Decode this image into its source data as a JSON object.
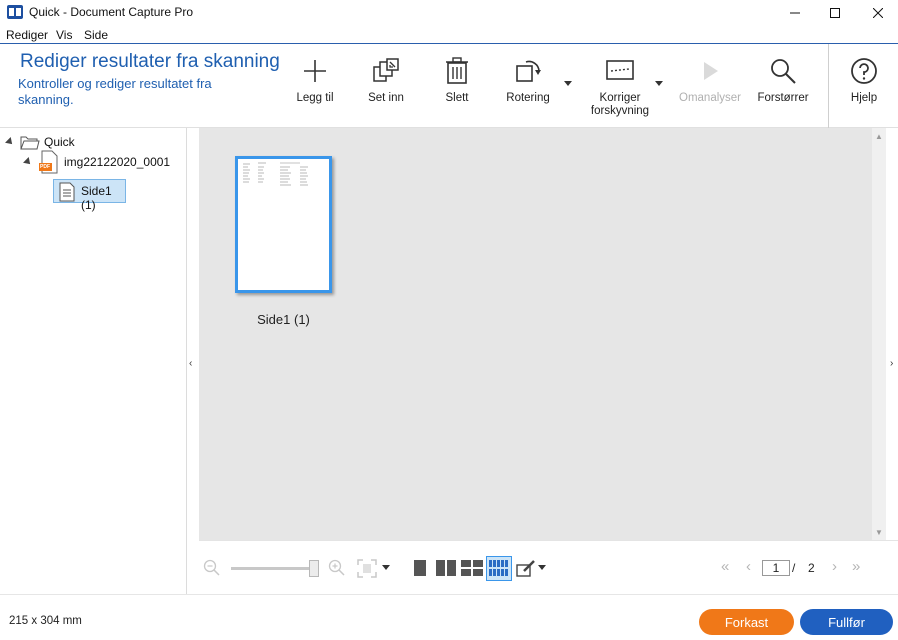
{
  "window": {
    "title": "Quick - Document Capture Pro"
  },
  "menu": [
    "Rediger",
    "Vis",
    "Side"
  ],
  "ribbon": {
    "heading": "Rediger resultater fra skanning",
    "subheading": "Kontroller og rediger resultatet fra skanning.",
    "tools": [
      {
        "label": "Legg til",
        "icon": "plus-icon",
        "enabled": true
      },
      {
        "label": "Set inn",
        "icon": "insert-icon",
        "enabled": true
      },
      {
        "label": "Slett",
        "icon": "trash-icon",
        "enabled": true
      },
      {
        "label": "Rotering",
        "icon": "rotate-icon",
        "enabled": true
      },
      {
        "label": "Korriger forskyvning",
        "icon": "deskew-icon",
        "enabled": true
      },
      {
        "label": "Omanalyser",
        "icon": "play-icon",
        "enabled": false
      },
      {
        "label": "Forstørrer",
        "icon": "magnifier-icon",
        "enabled": true
      },
      {
        "label": "Hjelp",
        "icon": "help-icon",
        "enabled": true
      }
    ]
  },
  "tree": {
    "root": "Quick",
    "file": "img22122020_0001",
    "file_badge": "PDF",
    "page": "Side1 (1)"
  },
  "content": {
    "thumbnail_label": "Side1 (1)"
  },
  "pager": {
    "current": "1",
    "separator": "/",
    "total": "2"
  },
  "status": {
    "paper_size": "215 x 304 mm"
  },
  "buttons": {
    "discard": "Forkast",
    "finish": "Fullfør"
  },
  "colors": {
    "accent_blue": "#1f5fb0",
    "selection_blue": "#3a96ea",
    "discard_orange": "#f07818",
    "finish_blue": "#2060c0"
  }
}
